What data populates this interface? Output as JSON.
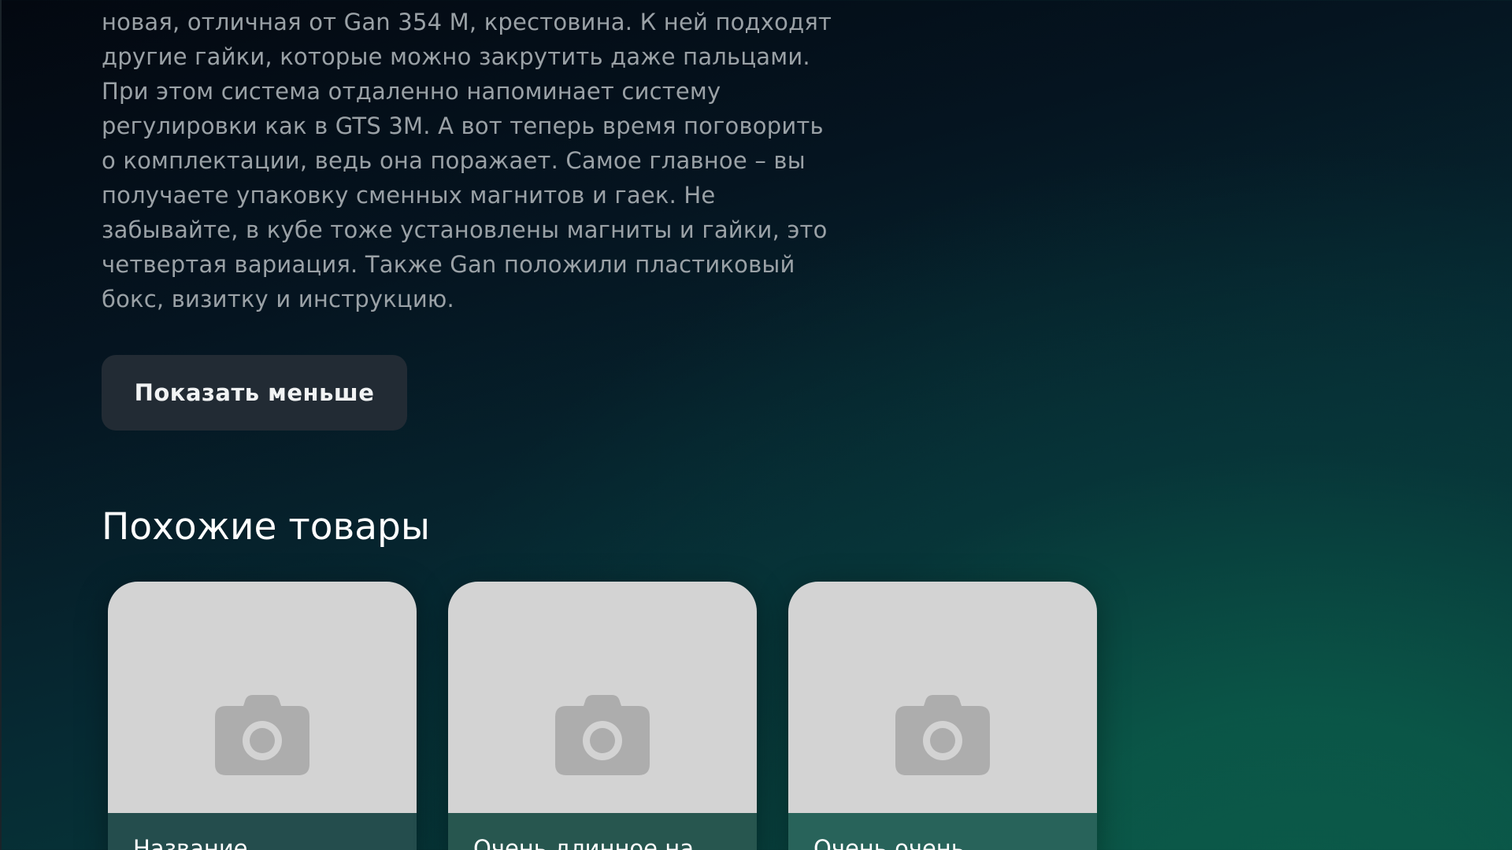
{
  "product": {
    "description_lines": [
      "новая, отличная от Gan 354 M, крестовина. К ней подходят",
      "другие гайки, которые можно закрутить даже пальцами.",
      "При этом система отдаленно напоминает систему",
      "регулировки как в GTS 3M. А вот теперь время поговорить",
      "о комплектации, ведь она поражает. Самое главное – вы",
      "получаете упаковку сменных магнитов и гаек. Не",
      "забывайте, в кубе тоже установлены магниты и гайки, это",
      "четвертая вариация. Также Gan положили пластиковый",
      "бокс, визитку и инструкцию."
    ],
    "show_less_label": "Показать меньше"
  },
  "similar": {
    "title": "Похожие товары",
    "cards": [
      {
        "name": "Название",
        "image_icon": "camera-icon"
      },
      {
        "name": "Очень длинное на",
        "image_icon": "camera-icon"
      },
      {
        "name": "Очень очень",
        "image_icon": "camera-icon"
      }
    ]
  },
  "colors": {
    "button_bg": "#222b34",
    "card_image_bg": "#d3d3d3",
    "placeholder_icon": "#adadad"
  }
}
